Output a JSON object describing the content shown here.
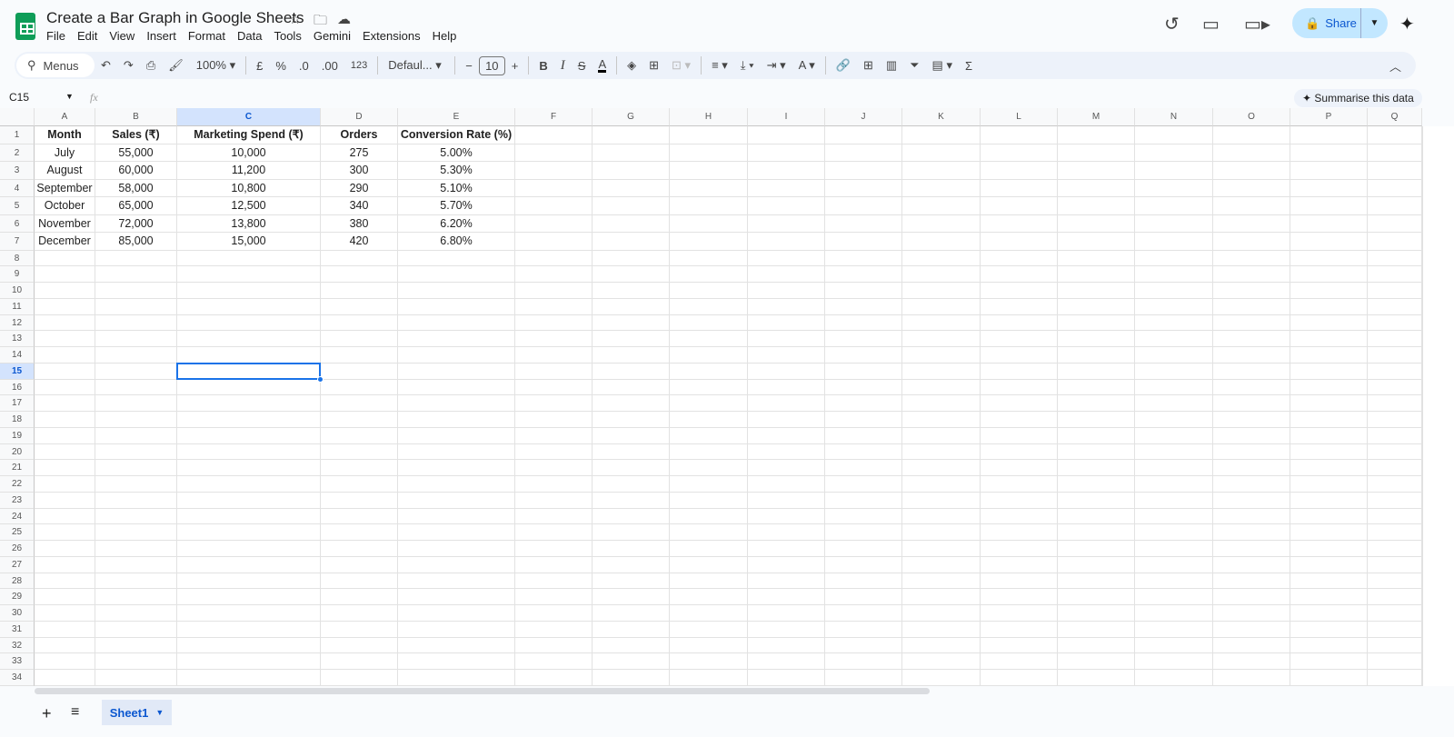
{
  "doc": {
    "title": "Create a Bar Graph in Google Sheets"
  },
  "menu": [
    "File",
    "Edit",
    "View",
    "Insert",
    "Format",
    "Data",
    "Tools",
    "Gemini",
    "Extensions",
    "Help"
  ],
  "share_label": "Share",
  "toolbar": {
    "menus": "Menus",
    "zoom": "100%",
    "currency": "£",
    "percent": "%",
    "dec_dec": ".0",
    "inc_dec": ".00",
    "format_123": "123",
    "font": "Defaul...",
    "font_size": "10",
    "bold": "B",
    "italic": "I",
    "sum": "Σ"
  },
  "formula_bar": {
    "name_box": "C15",
    "fx": "fx",
    "summarise": "Summarise this data"
  },
  "columns": [
    "A",
    "B",
    "C",
    "D",
    "E",
    "F",
    "G",
    "H",
    "I",
    "J",
    "K",
    "L",
    "M",
    "N",
    "O",
    "P",
    "Q"
  ],
  "selected_column": "C",
  "selected_row": 15,
  "rows": [
    [
      "Month",
      "Sales (₹)",
      "Marketing Spend (₹)",
      "Orders",
      "Conversion Rate (%)"
    ],
    [
      "July",
      "55,000",
      "10,000",
      "275",
      "5.00%"
    ],
    [
      "August",
      "60,000",
      "11,200",
      "300",
      "5.30%"
    ],
    [
      "September",
      "58,000",
      "10,800",
      "290",
      "5.10%"
    ],
    [
      "October",
      "65,000",
      "12,500",
      "340",
      "5.70%"
    ],
    [
      "November",
      "72,000",
      "13,800",
      "380",
      "6.20%"
    ],
    [
      "December",
      "85,000",
      "15,000",
      "420",
      "6.80%"
    ]
  ],
  "row_count": 34,
  "sheets": [
    {
      "name": "Sheet1",
      "active": true
    }
  ]
}
